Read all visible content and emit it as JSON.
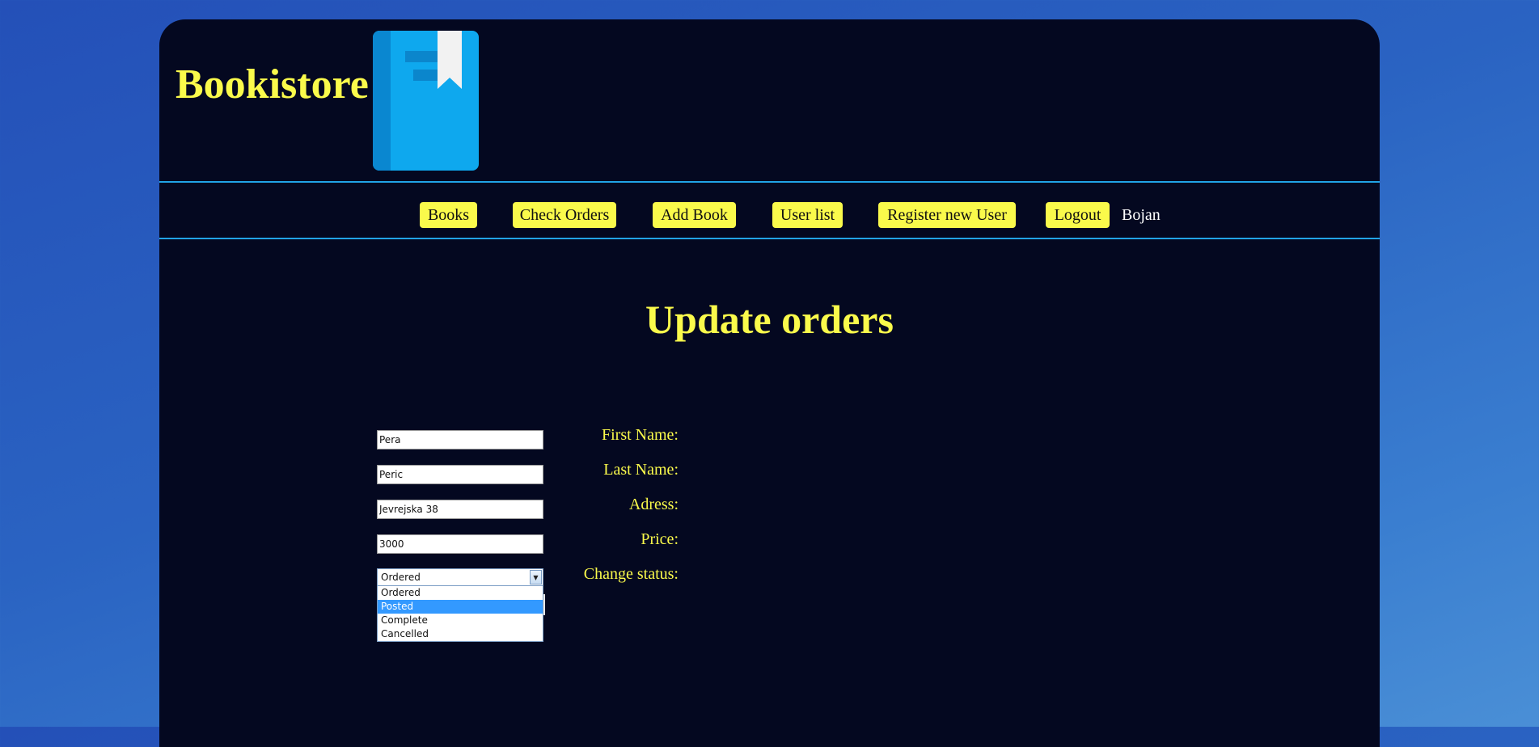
{
  "header": {
    "brand": "Bookistore"
  },
  "nav": {
    "items": [
      {
        "label": "Books"
      },
      {
        "label": "Check Orders"
      },
      {
        "label": "Add Book"
      },
      {
        "label": "User list"
      },
      {
        "label": "Register new User"
      },
      {
        "label": "Logout"
      }
    ],
    "username": "Bojan"
  },
  "main": {
    "title": "Update orders",
    "form": {
      "first_name": {
        "label": "First Name:",
        "value": "Pera"
      },
      "last_name": {
        "label": "Last Name:",
        "value": "Peric"
      },
      "address": {
        "label": "Adress:",
        "value": "Jevrejska 38"
      },
      "price": {
        "label": "Price:",
        "value": "3000"
      },
      "status": {
        "label": "Change status:",
        "selected": "Ordered",
        "highlighted": "Posted",
        "options": [
          "Ordered",
          "Posted",
          "Complete",
          "Cancelled"
        ]
      }
    }
  },
  "colors": {
    "accent": "#fafa4b",
    "panel": "#040820",
    "divider": "#21a4e6",
    "highlight": "#3399ff"
  }
}
